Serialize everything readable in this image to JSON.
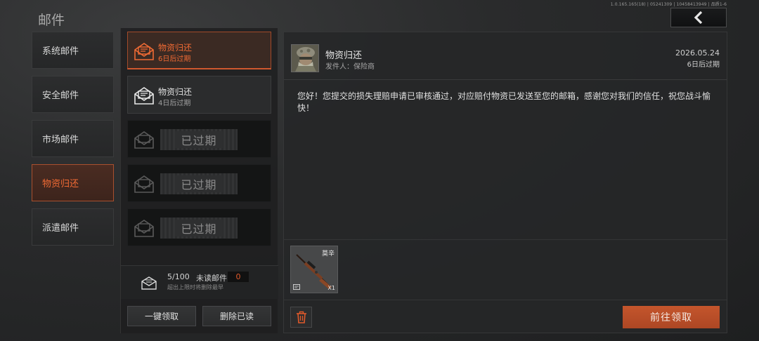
{
  "header": {
    "title": "邮件",
    "version_info": "1.0.165.165(18) | 05241309 | 10458413949 | 品质1-6",
    "back_icon": "chevron-left-icon"
  },
  "categories": [
    {
      "label": "系统邮件",
      "active": false
    },
    {
      "label": "安全邮件",
      "active": false
    },
    {
      "label": "市场邮件",
      "active": false
    },
    {
      "label": "物资归还",
      "active": true
    },
    {
      "label": "派遣邮件",
      "active": false
    }
  ],
  "mails": [
    {
      "title": "物资归还",
      "subtitle": "6日后过期",
      "state": "selected"
    },
    {
      "title": "物资归还",
      "subtitle": "4日后过期",
      "state": "normal"
    },
    {
      "stamp": "已过期",
      "state": "expired"
    },
    {
      "stamp": "已过期",
      "state": "expired"
    },
    {
      "stamp": "已过期",
      "state": "expired"
    }
  ],
  "list_footer": {
    "count": "5/100",
    "unread_label": "未读邮件",
    "unread_count": "0",
    "note": "超出上限时将删除最早"
  },
  "buttons": {
    "claim_all": "一键领取",
    "delete_read": "删除已读",
    "go_claim": "前往领取"
  },
  "detail": {
    "title": "物资归还",
    "sender": "发件人：保险商",
    "date": "2026.05.24",
    "expiry": "6日后过期",
    "body": "您好！您提交的损失理赔申请已审核通过，对应赔付物资已发送至您的邮箱，感谢您对我们的信任，祝您战斗愉快！",
    "attachment": {
      "name": "莫辛",
      "quantity": "X1",
      "icon": "sniper-rifle-icon"
    }
  },
  "colors": {
    "accent": "#e0592a",
    "claim_button": "#c4552c"
  }
}
